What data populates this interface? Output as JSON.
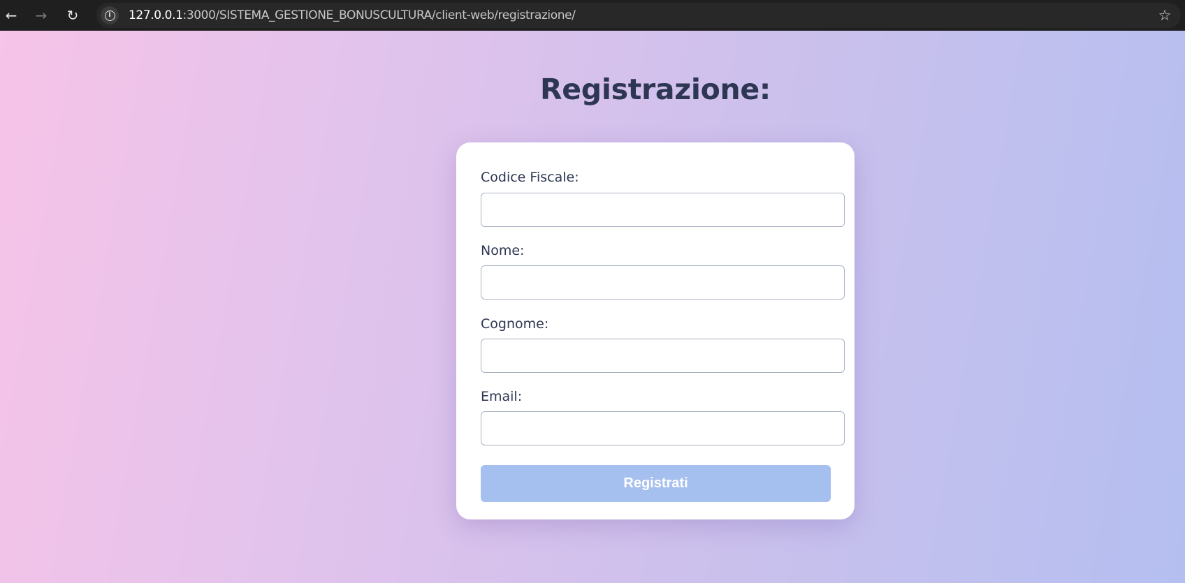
{
  "browser": {
    "url_host": "127.0.0.1",
    "url_path": ":3000/SISTEMA_GESTIONE_BONUSCULTURA/client-web/registrazione/",
    "icons": {
      "back": "arrow-left",
      "forward": "arrow-right",
      "reload": "reload",
      "site_info": "info",
      "bookmark": "star"
    }
  },
  "page": {
    "title": "Registrazione:",
    "form": {
      "fields": [
        {
          "label": "Codice Fiscale:",
          "value": ""
        },
        {
          "label": "Nome:",
          "value": ""
        },
        {
          "label": "Cognome:",
          "value": ""
        },
        {
          "label": "Email:",
          "value": ""
        }
      ],
      "submit_label": "Registrati"
    }
  },
  "colors": {
    "heading": "#2d3652",
    "button": "#a5bfee",
    "gradient_start": "#f7c3e8",
    "gradient_end": "#b4bff0"
  }
}
